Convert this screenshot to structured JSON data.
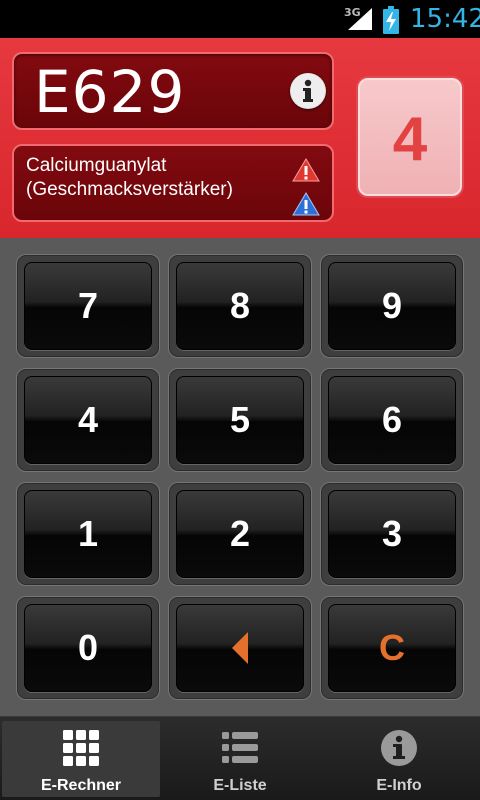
{
  "status_bar": {
    "network": "3G",
    "time": "15:42",
    "signal_icon": "signal-icon",
    "battery_icon": "battery-charging-icon"
  },
  "header": {
    "e_code": "E629",
    "name_line1": "Calciumguanylat",
    "name_line2": "(Geschmacksverstärker)",
    "rating": "4",
    "info_icon": "info-icon",
    "warning_icons": [
      "warning-red-icon",
      "warning-blue-icon"
    ],
    "colors": {
      "header_red": "#e6393f",
      "rating_text": "#e34242",
      "accent_orange": "#e4712b"
    }
  },
  "keypad": {
    "rows": [
      [
        {
          "label": "7"
        },
        {
          "label": "8"
        },
        {
          "label": "9"
        }
      ],
      [
        {
          "label": "4"
        },
        {
          "label": "5"
        },
        {
          "label": "6"
        }
      ],
      [
        {
          "label": "1"
        },
        {
          "label": "2"
        },
        {
          "label": "3"
        }
      ],
      [
        {
          "label": "0"
        },
        {
          "label": "",
          "icon": "backspace-arrow-icon"
        },
        {
          "label": "C"
        }
      ]
    ]
  },
  "nav": {
    "tabs": [
      {
        "label": "E-Rechner",
        "icon": "grid-icon",
        "active": true
      },
      {
        "label": "E-Liste",
        "icon": "list-icon",
        "active": false
      },
      {
        "label": "E-Info",
        "icon": "info-icon",
        "active": false
      }
    ]
  }
}
